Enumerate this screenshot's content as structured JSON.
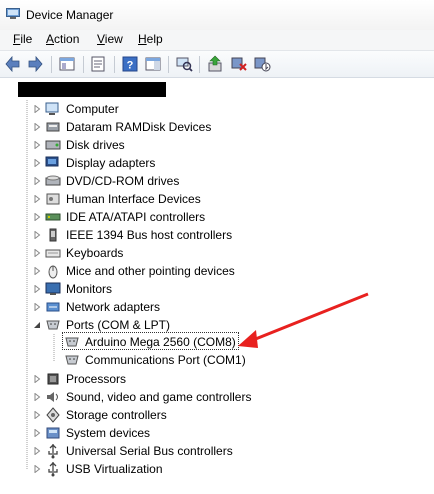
{
  "window": {
    "title": "Device Manager"
  },
  "menu": {
    "file": "F",
    "file_rest": "ile",
    "action": "A",
    "action_rest": "ction",
    "view": "V",
    "view_rest": "iew",
    "help": "H",
    "help_rest": "elp"
  },
  "tree": {
    "categories": [
      "Computer",
      "Dataram RAMDisk Devices",
      "Disk drives",
      "Display adapters",
      "DVD/CD-ROM drives",
      "Human Interface Devices",
      "IDE ATA/ATAPI controllers",
      "IEEE 1394 Bus host controllers",
      "Keyboards",
      "Mice and other pointing devices",
      "Monitors",
      "Network adapters",
      "Ports (COM & LPT)",
      "Processors",
      "Sound, video and game controllers",
      "Storage controllers",
      "System devices",
      "Universal Serial Bus controllers",
      "USB Virtualization"
    ],
    "ports_children": [
      "Arduino Mega 2560 (COM8)",
      "Communications Port (COM1)"
    ]
  },
  "colors": {
    "annotation_arrow": "#e8211f",
    "tree_line": "#a0a0a0"
  }
}
